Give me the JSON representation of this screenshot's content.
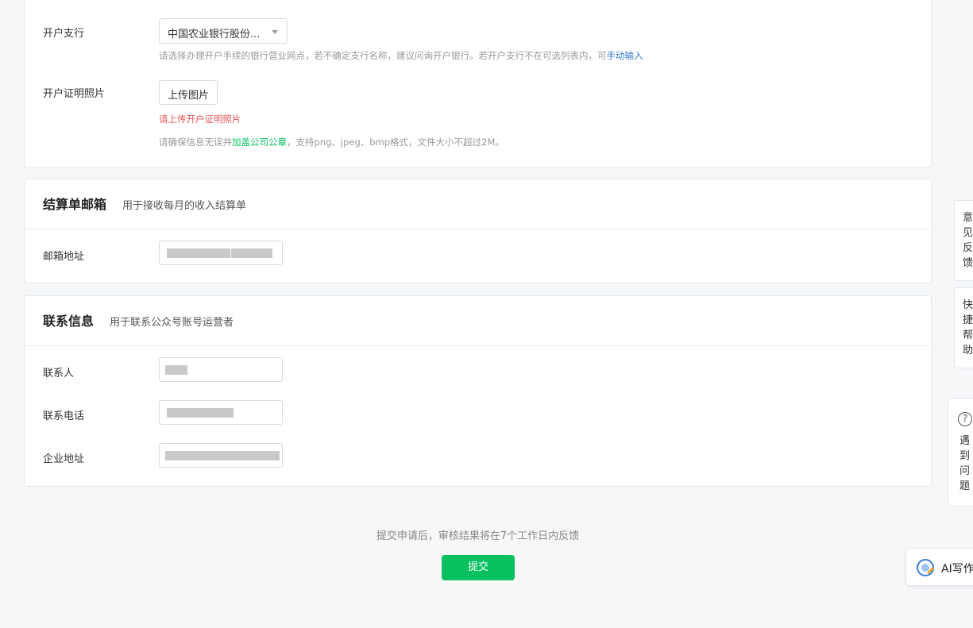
{
  "bank": {
    "branch_label": "开户支行",
    "branch_value": "中国农业银行股份...",
    "branch_hint": "请选择办理开户手续的银行营业网点，若不确定支行名称，建议问询开户银行。若开户支行不在可选列表内，可",
    "branch_hint_link": "手动输入",
    "proof_label": "开户证明照片",
    "upload_label": "上传图片",
    "upload_error": "请上传开户证明照片",
    "upload_hint_prefix": "请确保信息无误并",
    "upload_hint_link": "加盖公司公章",
    "upload_hint_suffix": "，支持png、jpeg、bmp格式，文件大小不超过2M。"
  },
  "email_section": {
    "title": "结算单邮箱",
    "subtitle": "用于接收每月的收入结算单",
    "email_label": "邮箱地址"
  },
  "contact_section": {
    "title": "联系信息",
    "subtitle": "用于联系公众号账号运营者",
    "contact_label": "联系人",
    "phone_label": "联系电话",
    "address_label": "企业地址"
  },
  "footer": {
    "note": "提交申请后，审核结果将在7个工作日内反馈",
    "submit_label": "提交"
  },
  "side": {
    "feedback_label": "意见反馈",
    "quick_help_label": "快捷帮助",
    "help_icon_glyph": "?",
    "help_label": "遇到问题",
    "ai_label": "AI写作"
  },
  "colors": {
    "accent_green": "#07c160",
    "link_blue": "#3a7bd5",
    "error_red": "#e55454"
  }
}
